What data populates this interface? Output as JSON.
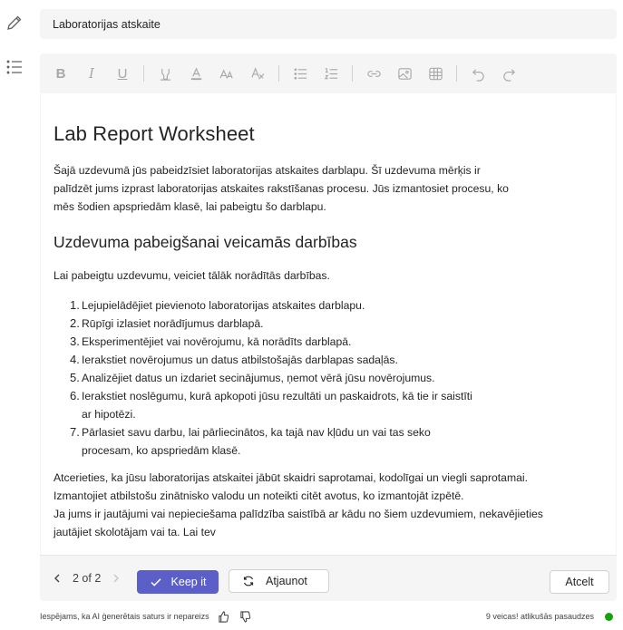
{
  "title_field": {
    "value": "Laboratorijas atskaite"
  },
  "rail": {
    "icons": [
      "edit-icon",
      "list-icon"
    ]
  },
  "toolbar": {
    "icons": [
      "bold-icon",
      "italic-icon",
      "underline-icon",
      "highlight-icon",
      "font-color-icon",
      "font-size-icon",
      "clear-format-icon",
      "bullet-list-icon",
      "numbered-list-icon",
      "link-icon",
      "image-icon",
      "table-icon",
      "undo-icon",
      "redo-icon"
    ],
    "bold_glyph": "B",
    "italic_glyph": "I",
    "underline_glyph": "U"
  },
  "document": {
    "title": "Lab Report Worksheet",
    "intro_paragraph": "Šajā uzdevumā jūs pabeidzīsiet laboratorijas atskaites darblapu. Šī uzdevuma mērķis ir palīdzēt jums izprast laboratorijas atskaites rakstīšanas procesu. Jūs izmantosiet procesu, ko mēs šodien apspriedām klasē, lai pabeigtu šo darblapu.",
    "section_heading": "Uzdevuma pabeigšanai veicamās darbības",
    "steps_intro": "Lai pabeigtu uzdevumu, veiciet tālāk norādītās darbības.",
    "steps": [
      {
        "num": "1.",
        "text": "Lejupielādējiet pievienoto laboratorijas atskaites darblapu."
      },
      {
        "num": "2.",
        "text": "Rūpīgi izlasiet norādījumus darblapā."
      },
      {
        "num": "3.",
        "text": "Eksperimentējiet vai novērojumu, kā norādīts darblapā."
      },
      {
        "num": "4.",
        "text": "Ierakstiet novērojumus un datus atbilstošajās darblapas sadaļās."
      },
      {
        "num": "5.",
        "text": "Analizējiet datus un izdariet secinājumus, ņemot vērā jūsu novērojumus."
      },
      {
        "num": "6.",
        "text": "Ierakstiet noslēgumu, kurā apkopoti jūsu rezultāti un paskaidrots, kā tie ir saistīti ar hipotēzi."
      },
      {
        "num": "7.",
        "text": "Pārlasiet savu darbu, lai pārliecinātos, ka tajā nav kļūdu un vai tas seko procesam, ko apspriedām klasē."
      }
    ],
    "closing_paragraph": "Atcerieties, ka jūsu laboratorijas atskaitei jābūt skaidri saprotamai, kodolīgai un viegli saprotamai. Izmantojiet atbilstošu zinātnisko valodu un noteikti citēt avotus, ko izmantojāt izpētē.",
    "closing_paragraph_2": "Ja jums ir jautājumi vai nepieciešama palīdzība saistībā ar kādu no šiem uzdevumiem, nekavējieties jautājiet skolotājam vai ta. Lai tev"
  },
  "actions": {
    "pager": "2 of 2",
    "keep_label": "Keep it",
    "refresh_label": "Atjaunot",
    "cancel_label": "Atcelt"
  },
  "footer": {
    "disclaimer": "Iespējams, ka AI ģenerētais saturs ir nepareizs",
    "remaining": "9 veicas! atlikušās pasaudzes",
    "status_color": "#13a10e"
  },
  "colors": {
    "accent": "#5b5fc7"
  }
}
